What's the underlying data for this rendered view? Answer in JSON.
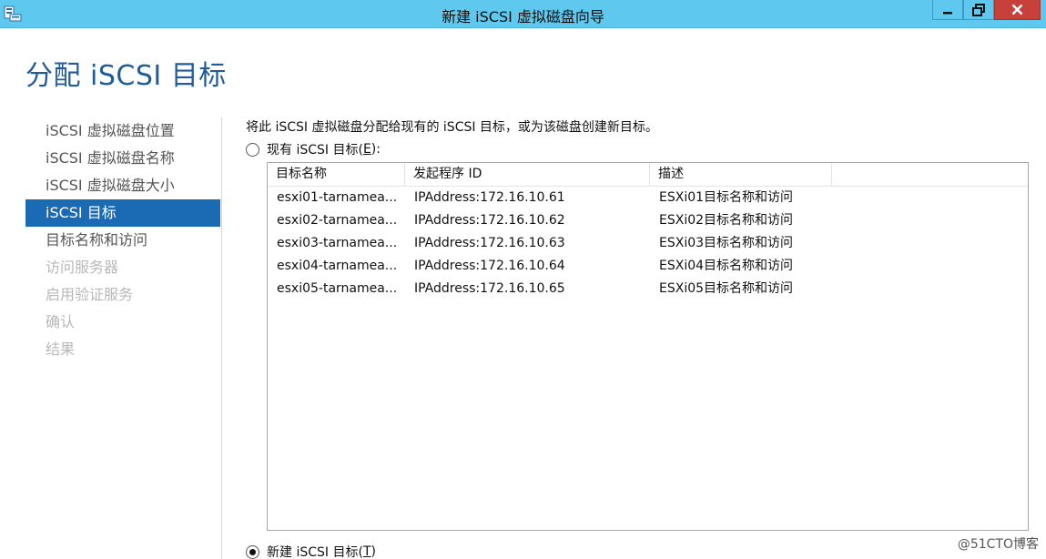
{
  "window": {
    "title": "新建 iSCSI 虚拟磁盘向导",
    "controls": {
      "minimize_icon": "minimize-icon",
      "restore_icon": "restore-icon",
      "close_icon": "close-icon"
    }
  },
  "page": {
    "title": "分配 iSCSI 目标"
  },
  "nav": {
    "items": [
      {
        "label": "iSCSI 虚拟磁盘位置",
        "state": "done"
      },
      {
        "label": "iSCSI 虚拟磁盘名称",
        "state": "done"
      },
      {
        "label": "iSCSI 虚拟磁盘大小",
        "state": "done"
      },
      {
        "label": "iSCSI 目标",
        "state": "active"
      },
      {
        "label": "目标名称和访问",
        "state": "enabled"
      },
      {
        "label": "访问服务器",
        "state": "disabled"
      },
      {
        "label": "启用验证服务",
        "state": "disabled"
      },
      {
        "label": "确认",
        "state": "disabled"
      },
      {
        "label": "结果",
        "state": "disabled"
      }
    ]
  },
  "main": {
    "intro": "将此 iSCSI 虚拟磁盘分配给现有的 iSCSI 目标，或为该磁盘创建新目标。",
    "existing_option": {
      "prefix": "现有 iSCSI 目标(",
      "key": "E",
      "suffix": "):",
      "checked": false
    },
    "new_option": {
      "prefix": "新建 iSCSI 目标(",
      "key": "T",
      "suffix": ")",
      "checked": true
    },
    "table": {
      "columns": [
        "目标名称",
        "发起程序 ID",
        "描述",
        ""
      ],
      "rows": [
        [
          "esxi01-tarnamea...",
          "IPAddress:172.16.10.61",
          "ESXi01目标名称和访问"
        ],
        [
          "esxi02-tarnamea...",
          "IPAddress:172.16.10.62",
          "ESXi02目标名称和访问"
        ],
        [
          "esxi03-tarnamea...",
          "IPAddress:172.16.10.63",
          "ESXi03目标名称和访问"
        ],
        [
          "esxi04-tarnamea...",
          "IPAddress:172.16.10.64",
          "ESXi04目标名称和访问"
        ],
        [
          "esxi05-tarnamea...",
          "IPAddress:172.16.10.65",
          "ESXi05目标名称和访问"
        ]
      ]
    }
  },
  "watermark": "@51CTO博客",
  "colors": {
    "titlebar": "#5fc8ee",
    "accent": "#1b6bb4",
    "heading": "#1f5c99",
    "close": "#c7413a"
  }
}
